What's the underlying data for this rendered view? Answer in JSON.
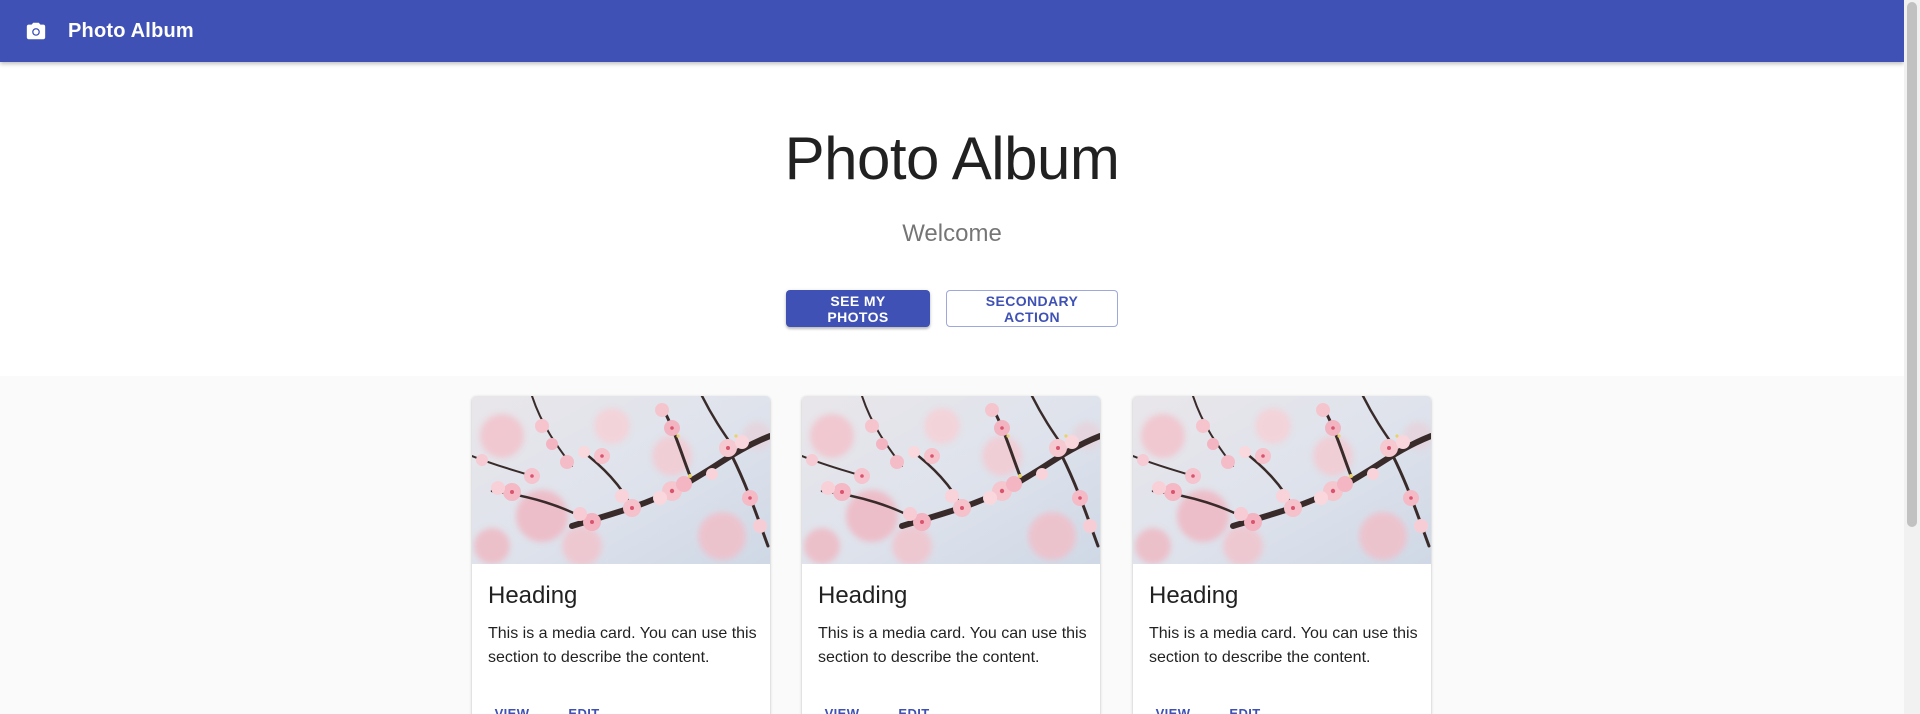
{
  "app_bar": {
    "icon": "camera-icon",
    "title": "Photo Album",
    "background": "#3f51b5"
  },
  "hero": {
    "title": "Photo Album",
    "subtitle": "Welcome",
    "primary_button": "SEE MY PHOTOS",
    "secondary_button": "SECONDARY ACTION"
  },
  "cards": [
    {
      "image": "cherry-blossom-photo",
      "heading": "Heading",
      "description": "This is a media card. You can use this section to describe the content.",
      "actions": [
        "VIEW",
        "EDIT"
      ]
    },
    {
      "image": "cherry-blossom-photo",
      "heading": "Heading",
      "description": "This is a media card. You can use this section to describe the content.",
      "actions": [
        "VIEW",
        "EDIT"
      ]
    },
    {
      "image": "cherry-blossom-photo",
      "heading": "Heading",
      "description": "This is a media card. You can use this section to describe the content.",
      "actions": [
        "VIEW",
        "EDIT"
      ]
    }
  ],
  "colors": {
    "primary": "#3f51b5",
    "page_background": "#fafafa",
    "card_background": "#ffffff"
  }
}
